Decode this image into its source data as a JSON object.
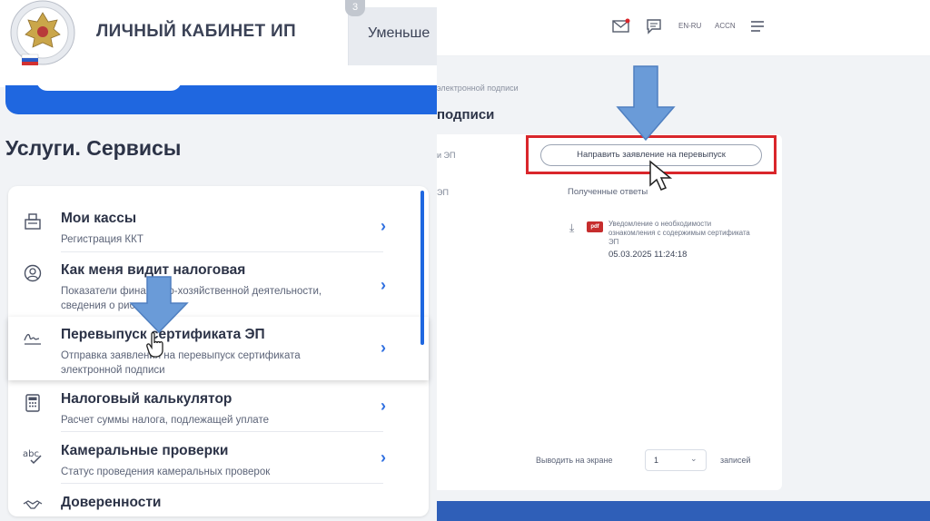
{
  "left": {
    "header": {
      "title": "ЛИЧНЫЙ КАБИНЕТ ИП",
      "tab_badge": "3",
      "tab_label": "Уменьше"
    },
    "section_title": "Услуги. Сервисы",
    "services": [
      {
        "title": "Мои кассы",
        "subtitle": "Регистрация ККТ",
        "icon": "cash-register-icon"
      },
      {
        "title": "Как меня видит налоговая",
        "subtitle": "Показатели финансово-хозяйственной деятельности, сведения о рисках",
        "icon": "person-search-icon"
      },
      {
        "title": "Перевыпуск сертификата ЭП",
        "subtitle": "Отправка заявления на перевыпуск сертификата электронной подписи",
        "icon": "signature-icon"
      },
      {
        "title": "Налоговый калькулятор",
        "subtitle": "Расчет суммы налога, подлежащей уплате",
        "icon": "calculator-icon"
      },
      {
        "title": "Камеральные проверки",
        "subtitle": "Статус проведения камеральных проверок",
        "icon": "spellcheck-icon"
      },
      {
        "title": "Доверенности",
        "subtitle": "",
        "icon": "handshake-icon"
      }
    ]
  },
  "right": {
    "breadcrumb": "электронной подписи",
    "heading": "подписи",
    "column_a": "и ЭП",
    "column_b": "ЭП",
    "reissue_button": "Направить заявление на перевыпуск",
    "answers_label": "Полученные ответы",
    "notice": {
      "badge": "pdf",
      "text": "Уведомление о необходимости ознакомления с содержимым сертификата ЭП",
      "date": "05.03.2025 11:24:18"
    },
    "header_texts": [
      "EN-RU",
      "ACCN"
    ],
    "pager": {
      "label": "Выводить на экране",
      "value": "1",
      "suffix": "записей"
    }
  },
  "colors": {
    "accent_blue": "#1f67e0",
    "highlight_red": "#d9262b",
    "annotation_arrow": "#6a9bd8"
  }
}
